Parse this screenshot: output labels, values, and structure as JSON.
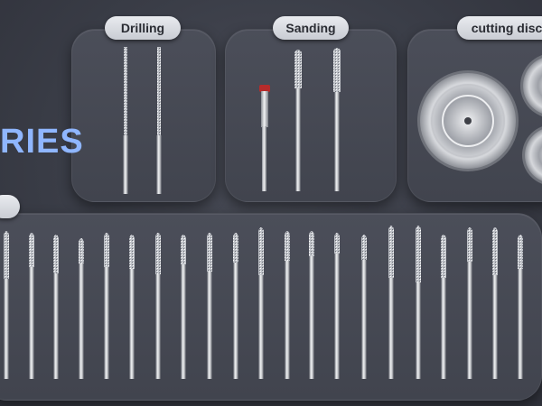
{
  "categories": {
    "drilling": "Drilling",
    "sanding": "Sanding",
    "cutting": "cutting disc"
  },
  "heading_fragment": "RIES",
  "colors": {
    "background": "#3a3d47",
    "accent_text": "#8fb6ff",
    "pill": "#dcdfe5",
    "metal": "#c8cbd1"
  }
}
